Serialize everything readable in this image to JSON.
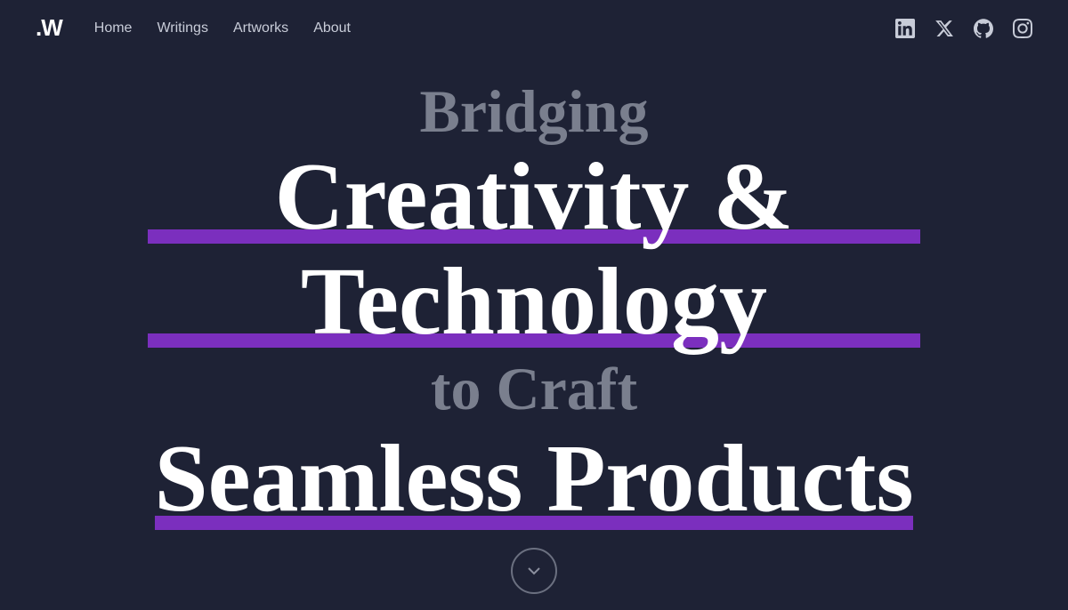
{
  "nav": {
    "logo": ".W",
    "links": [
      {
        "label": "Home",
        "href": "#"
      },
      {
        "label": "Writings",
        "href": "#"
      },
      {
        "label": "Artworks",
        "href": "#"
      },
      {
        "label": "About",
        "href": "#"
      }
    ],
    "socials": [
      {
        "name": "linkedin",
        "label": "LinkedIn"
      },
      {
        "name": "twitter",
        "label": "Twitter/X"
      },
      {
        "name": "github",
        "label": "GitHub"
      },
      {
        "name": "instagram",
        "label": "Instagram"
      }
    ]
  },
  "hero": {
    "line1": "Bridging",
    "line2": "Creativity &",
    "line3": "Technology",
    "line4": "to Craft",
    "line5": "Seamless Products"
  },
  "colors": {
    "bg": "#1e2235",
    "accent": "#7b2fbe",
    "text_white": "#ffffff",
    "text_muted": "#7a7f8e"
  }
}
